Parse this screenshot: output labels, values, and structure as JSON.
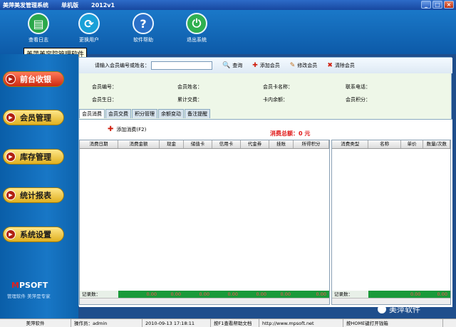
{
  "window": {
    "title": "美萍美发管理系统",
    "edition": "单机版",
    "version": "2012v1",
    "controls": [
      "_",
      "□",
      "×"
    ]
  },
  "toolbar": {
    "items": [
      {
        "label": "查看日志",
        "icon": "log-icon"
      },
      {
        "label": "更换用户",
        "icon": "refresh-user-icon"
      },
      {
        "label": "软件帮助",
        "icon": "help-icon"
      },
      {
        "label": "退出系统",
        "icon": "power-icon"
      }
    ],
    "tooltip": "美萍美容院管理软件"
  },
  "sidebar": {
    "items": [
      {
        "label": "前台收银",
        "active": true
      },
      {
        "label": "会员管理",
        "active": false
      },
      {
        "label": "库存管理",
        "active": false
      },
      {
        "label": "统计报表",
        "active": false
      },
      {
        "label": "系统设置",
        "active": false
      }
    ],
    "logo_m": "M",
    "logo_rest": "PSOFT",
    "slogan": "管理软件  美萍是专家"
  },
  "search": {
    "label": "请输入会员编号或姓名：",
    "value": "",
    "query_label": "查询",
    "add_label": "添加会员",
    "edit_label": "修改会员",
    "clear_label": "清除会员"
  },
  "member_info": {
    "id_label": "会员编号：",
    "name_label": "会员姓名：",
    "card_label": "会员卡名称：",
    "phone_label": "联系电话：",
    "birthday_label": "会员生日：",
    "spent_label": "累计交费：",
    "balance_label": "卡内余额：",
    "points_label": "会员积分："
  },
  "tabs": [
    "会员消费",
    "会员交费",
    "积分管理",
    "余额变动",
    "备注提醒"
  ],
  "consume": {
    "add_label": "添加消费(F2)",
    "total_label": "消费总额：0 元"
  },
  "left_grid": {
    "columns": [
      "消费日期",
      "消费金额",
      "现金",
      "储值卡",
      "信用卡",
      "代金券",
      "挂账",
      "所得积分"
    ],
    "footer_label": "记录数：",
    "footer_values": [
      "0.00",
      "0.00",
      "0.00",
      "0.00",
      "0.00",
      "0.00",
      "0.00"
    ]
  },
  "right_grid": {
    "columns": [
      "消费类型",
      "名称",
      "单价",
      "数量/次数"
    ],
    "footer_label": "记录数：",
    "footer_values": [
      "0.00",
      "0.00"
    ]
  },
  "statusbar": {
    "app": "美萍软件",
    "operator": "操作员：admin",
    "datetime": "2010-09-13 17:18:11",
    "help": "按F1查看帮助文档",
    "url": "http://www.mpsoft.net",
    "home": "按HOME键打开钱箱"
  },
  "watermark": "美萍软件"
}
